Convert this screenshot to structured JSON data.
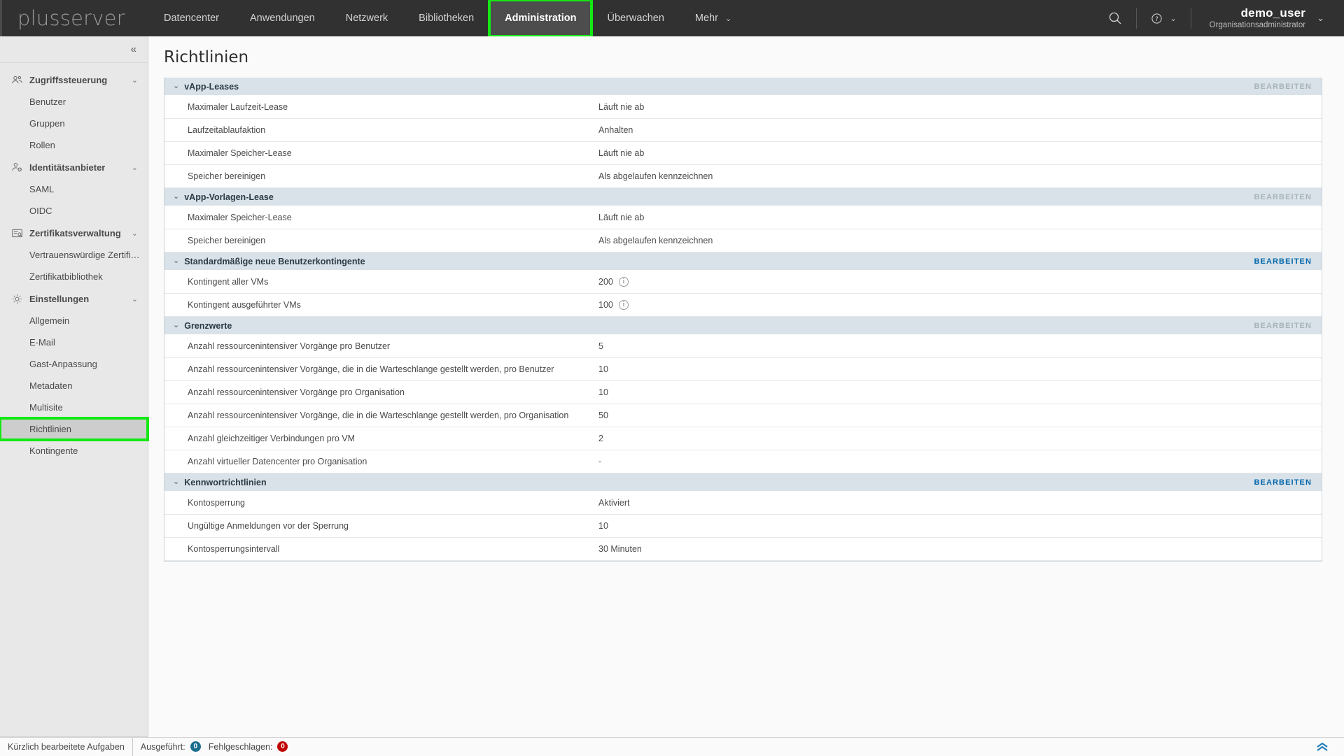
{
  "topbar": {
    "brand": "plusserver",
    "nav": [
      {
        "label": "Datencenter",
        "active": false,
        "highlighted": false,
        "caret": false
      },
      {
        "label": "Anwendungen",
        "active": false,
        "highlighted": false,
        "caret": false
      },
      {
        "label": "Netzwerk",
        "active": false,
        "highlighted": false,
        "caret": false
      },
      {
        "label": "Bibliotheken",
        "active": false,
        "highlighted": false,
        "caret": false
      },
      {
        "label": "Administration",
        "active": true,
        "highlighted": true,
        "caret": false
      },
      {
        "label": "Überwachen",
        "active": false,
        "highlighted": false,
        "caret": false
      },
      {
        "label": "Mehr",
        "active": false,
        "highlighted": false,
        "caret": true
      }
    ],
    "search_icon": "search-icon",
    "help_icon": "help-icon",
    "user_name": "demo_user",
    "user_role": "Organisationsadministrator"
  },
  "sidebar": {
    "collapse_icon": "«",
    "groups": [
      {
        "label": "Zugriffssteuerung",
        "icon": "users-group-icon",
        "caret": "⌄",
        "children": [
          {
            "label": "Benutzer",
            "selected": false,
            "highlighted": false
          },
          {
            "label": "Gruppen",
            "selected": false,
            "highlighted": false
          },
          {
            "label": "Rollen",
            "selected": false,
            "highlighted": false
          }
        ]
      },
      {
        "label": "Identitätsanbieter",
        "icon": "user-gear-icon",
        "caret": "⌄",
        "children": [
          {
            "label": "SAML",
            "selected": false,
            "highlighted": false
          },
          {
            "label": "OIDC",
            "selected": false,
            "highlighted": false
          }
        ]
      },
      {
        "label": "Zertifikatsverwaltung",
        "icon": "certificate-icon",
        "caret": "⌄",
        "children": [
          {
            "label": "Vertrauenswürdige Zertifi…",
            "selected": false,
            "highlighted": false
          },
          {
            "label": "Zertifikatbibliothek",
            "selected": false,
            "highlighted": false
          }
        ]
      },
      {
        "label": "Einstellungen",
        "icon": "gear-icon",
        "caret": "⌄",
        "children": [
          {
            "label": "Allgemein",
            "selected": false,
            "highlighted": false
          },
          {
            "label": "E-Mail",
            "selected": false,
            "highlighted": false
          },
          {
            "label": "Gast-Anpassung",
            "selected": false,
            "highlighted": false
          },
          {
            "label": "Metadaten",
            "selected": false,
            "highlighted": false
          },
          {
            "label": "Multisite",
            "selected": false,
            "highlighted": false
          },
          {
            "label": "Richtlinien",
            "selected": true,
            "highlighted": true
          },
          {
            "label": "Kontingente",
            "selected": false,
            "highlighted": false
          }
        ]
      }
    ]
  },
  "main": {
    "page_title": "Richtlinien",
    "edit_label": "BEARBEITEN",
    "sections": [
      {
        "title": "vApp-Leases",
        "caret": "⌄",
        "edit_enabled": false,
        "rows": [
          {
            "label": "Maximaler Laufzeit-Lease",
            "value": "Läuft nie ab",
            "info": false
          },
          {
            "label": "Laufzeitablaufaktion",
            "value": "Anhalten",
            "info": false
          },
          {
            "label": "Maximaler Speicher-Lease",
            "value": "Läuft nie ab",
            "info": false
          },
          {
            "label": "Speicher bereinigen",
            "value": "Als abgelaufen kennzeichnen",
            "info": false
          }
        ]
      },
      {
        "title": "vApp-Vorlagen-Lease",
        "caret": "⌄",
        "edit_enabled": false,
        "rows": [
          {
            "label": "Maximaler Speicher-Lease",
            "value": "Läuft nie ab",
            "info": false
          },
          {
            "label": "Speicher bereinigen",
            "value": "Als abgelaufen kennzeichnen",
            "info": false
          }
        ]
      },
      {
        "title": "Standardmäßige neue Benutzerkontingente",
        "caret": "⌄",
        "edit_enabled": true,
        "rows": [
          {
            "label": "Kontingent aller VMs",
            "value": "200",
            "info": true
          },
          {
            "label": "Kontingent ausgeführter VMs",
            "value": "100",
            "info": true
          }
        ]
      },
      {
        "title": "Grenzwerte",
        "caret": "⌄",
        "edit_enabled": false,
        "rows": [
          {
            "label": "Anzahl ressourcenintensiver Vorgänge pro Benutzer",
            "value": "5",
            "info": false
          },
          {
            "label": "Anzahl ressourcenintensiver Vorgänge, die in die Warteschlange gestellt werden, pro Benutzer",
            "value": "10",
            "info": false
          },
          {
            "label": "Anzahl ressourcenintensiver Vorgänge pro Organisation",
            "value": "10",
            "info": false
          },
          {
            "label": "Anzahl ressourcenintensiver Vorgänge, die in die Warteschlange gestellt werden, pro Organisation",
            "value": "50",
            "info": false
          },
          {
            "label": "Anzahl gleichzeitiger Verbindungen pro VM",
            "value": "2",
            "info": false
          },
          {
            "label": "Anzahl virtueller Datencenter pro Organisation",
            "value": "-",
            "info": false
          }
        ]
      },
      {
        "title": "Kennwortrichtlinien",
        "caret": "⌄",
        "edit_enabled": true,
        "rows": [
          {
            "label": "Kontosperrung",
            "value": "Aktiviert",
            "info": false
          },
          {
            "label": "Ungültige Anmeldungen vor der Sperrung",
            "value": "10",
            "info": false
          },
          {
            "label": "Kontosperrungsintervall",
            "value": "30 Minuten",
            "info": false
          }
        ]
      }
    ]
  },
  "statusbar": {
    "tasks_label": "Kürzlich bearbeitete Aufgaben",
    "running_label": "Ausgeführt:",
    "running_count": "0",
    "failed_label": "Fehlgeschlagen:",
    "failed_count": "0",
    "scroll_top_icon": "chevron-up-icon"
  },
  "colors": {
    "topbar_bg": "#313131",
    "nav_active_bg": "#4d4d4d",
    "highlight_green": "#14e814",
    "sidebar_bg": "#e8e8e8",
    "section_header_bg": "#d9e2e8",
    "link_blue": "#0065ab",
    "link_disabled": "#a6b3bb",
    "badge_running": "#1b6e8c",
    "badge_failed": "#c00000"
  }
}
